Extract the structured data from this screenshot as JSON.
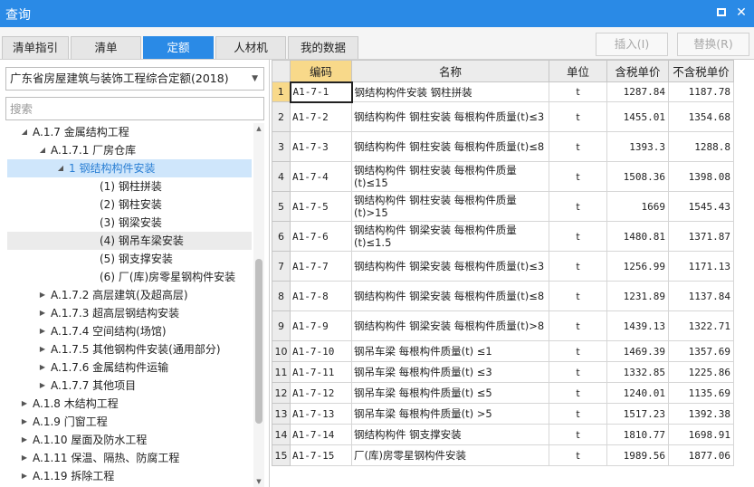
{
  "window": {
    "title": "查询"
  },
  "tabs": [
    {
      "label": "清单指引",
      "active": false
    },
    {
      "label": "清单",
      "active": false
    },
    {
      "label": "定额",
      "active": true
    },
    {
      "label": "人材机",
      "active": false
    },
    {
      "label": "我的数据",
      "active": false
    }
  ],
  "actions": {
    "insert_label": "插入(I)",
    "replace_label": "替换(R)"
  },
  "left": {
    "quota_library": "广东省房屋建筑与装饰工程综合定额(2018)",
    "search_placeholder": "搜索",
    "tree": [
      {
        "label": "A.1.7 金属结构工程",
        "level": 0,
        "expanded": true
      },
      {
        "label": "A.1.7.1 厂房仓库",
        "level": 1,
        "expanded": true
      },
      {
        "label": "1 钢结构构件安装",
        "level": 2,
        "expanded": true,
        "selected": true
      },
      {
        "label": "(1) 钢柱拼装",
        "level": 3
      },
      {
        "label": "(2) 钢柱安装",
        "level": 3
      },
      {
        "label": "(3) 钢梁安装",
        "level": 3
      },
      {
        "label": "(4) 钢吊车梁安装",
        "level": 3,
        "hover": true
      },
      {
        "label": "(5) 钢支撑安装",
        "level": 3
      },
      {
        "label": "(6) 厂(库)房零星钢构件安装",
        "level": 3
      },
      {
        "label": "A.1.7.2 高层建筑(及超高层)",
        "level": 1,
        "expanded": false
      },
      {
        "label": "A.1.7.3 超高层钢结构安装",
        "level": 1,
        "expanded": false
      },
      {
        "label": "A.1.7.4 空间结构(场馆)",
        "level": 1,
        "expanded": false
      },
      {
        "label": "A.1.7.5 其他钢构件安装(通用部分)",
        "level": 1,
        "expanded": false
      },
      {
        "label": "A.1.7.6 金属结构件运输",
        "level": 1,
        "expanded": false
      },
      {
        "label": "A.1.7.7 其他项目",
        "level": 1,
        "expanded": false
      },
      {
        "label": "A.1.8 木结构工程",
        "level": 0,
        "expanded": false
      },
      {
        "label": "A.1.9 门窗工程",
        "level": 0,
        "expanded": false
      },
      {
        "label": "A.1.10 屋面及防水工程",
        "level": 0,
        "expanded": false
      },
      {
        "label": "A.1.11 保温、隔热、防腐工程",
        "level": 0,
        "expanded": false
      },
      {
        "label": "A.1.19 拆除工程",
        "level": 0,
        "expanded": false
      }
    ]
  },
  "grid": {
    "columns": [
      "",
      "编码",
      "名称",
      "单位",
      "含税单价",
      "不含税单价"
    ],
    "rows": [
      {
        "n": "1",
        "code": "A1-7-1",
        "name": "钢结构构件安装 钢柱拼装",
        "unit": "t",
        "tax": "1287.84",
        "notax": "1187.78"
      },
      {
        "n": "2",
        "code": "A1-7-2",
        "name": "钢结构构件 钢柱安装 每根构件质量(t)≤3",
        "unit": "t",
        "tax": "1455.01",
        "notax": "1354.68"
      },
      {
        "n": "3",
        "code": "A1-7-3",
        "name": "钢结构构件 钢柱安装 每根构件质量(t)≤8",
        "unit": "t",
        "tax": "1393.3",
        "notax": "1288.8"
      },
      {
        "n": "4",
        "code": "A1-7-4",
        "name": "钢结构构件 钢柱安装 每根构件质量(t)≤15",
        "unit": "t",
        "tax": "1508.36",
        "notax": "1398.08"
      },
      {
        "n": "5",
        "code": "A1-7-5",
        "name": "钢结构构件 钢柱安装 每根构件质量(t)>15",
        "unit": "t",
        "tax": "1669",
        "notax": "1545.43"
      },
      {
        "n": "6",
        "code": "A1-7-6",
        "name": "钢结构构件 钢梁安装 每根构件质量(t)≤1.5",
        "unit": "t",
        "tax": "1480.81",
        "notax": "1371.87"
      },
      {
        "n": "7",
        "code": "A1-7-7",
        "name": "钢结构构件 钢梁安装 每根构件质量(t)≤3",
        "unit": "t",
        "tax": "1256.99",
        "notax": "1171.13"
      },
      {
        "n": "8",
        "code": "A1-7-8",
        "name": "钢结构构件 钢梁安装 每根构件质量(t)≤8",
        "unit": "t",
        "tax": "1231.89",
        "notax": "1137.84"
      },
      {
        "n": "9",
        "code": "A1-7-9",
        "name": "钢结构构件 钢梁安装 每根构件质量(t)>8",
        "unit": "t",
        "tax": "1439.13",
        "notax": "1322.71"
      },
      {
        "n": "10",
        "code": "A1-7-10",
        "name": "钢吊车梁 每根构件质量(t) ≤1",
        "unit": "t",
        "tax": "1469.39",
        "notax": "1357.69"
      },
      {
        "n": "11",
        "code": "A1-7-11",
        "name": "钢吊车梁 每根构件质量(t) ≤3",
        "unit": "t",
        "tax": "1332.85",
        "notax": "1225.86"
      },
      {
        "n": "12",
        "code": "A1-7-12",
        "name": "钢吊车梁 每根构件质量(t) ≤5",
        "unit": "t",
        "tax": "1240.01",
        "notax": "1135.69"
      },
      {
        "n": "13",
        "code": "A1-7-13",
        "name": "钢吊车梁 每根构件质量(t) >5",
        "unit": "t",
        "tax": "1517.23",
        "notax": "1392.38"
      },
      {
        "n": "14",
        "code": "A1-7-14",
        "name": "钢结构构件 钢支撑安装",
        "unit": "t",
        "tax": "1810.77",
        "notax": "1698.91"
      },
      {
        "n": "15",
        "code": "A1-7-15",
        "name": "厂(库)房零星钢构件安装",
        "unit": "t",
        "tax": "1989.56",
        "notax": "1877.06"
      }
    ]
  }
}
